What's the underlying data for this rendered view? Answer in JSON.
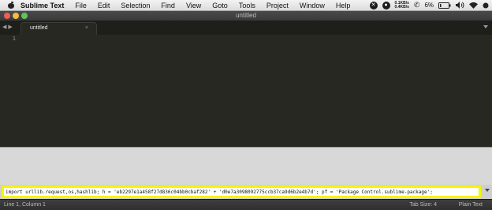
{
  "menubar": {
    "app_name": "Sublime Text",
    "items": [
      "File",
      "Edit",
      "Selection",
      "Find",
      "View",
      "Goto",
      "Tools",
      "Project",
      "Window",
      "Help"
    ],
    "tray": {
      "net_up": "0.1KB/s",
      "net_down": "0.4KB/s",
      "battery": "6%",
      "volume_icon": "speaker-icon",
      "wifi_icon": "wifi-icon"
    }
  },
  "window": {
    "title": "untitled"
  },
  "tabs": [
    {
      "label": "untitled",
      "close": "×"
    }
  ],
  "editor": {
    "line_numbers": [
      "1"
    ],
    "content": ""
  },
  "console": {
    "input_value": "import urllib.request,os,hashlib; h = 'eb2297e1a458f27d836c04bb0cbaf282' + 'd0e7a3098092775ccb37ca9d6b2e4b7d'; pf = 'Package Control.sublime-package';"
  },
  "statusbar": {
    "position": "Line 1, Column 1",
    "tab_size": "Tab Size: 4",
    "syntax": "Plain Text"
  },
  "colors": {
    "editor_bg": "#272822",
    "highlight": "#f5f500"
  }
}
